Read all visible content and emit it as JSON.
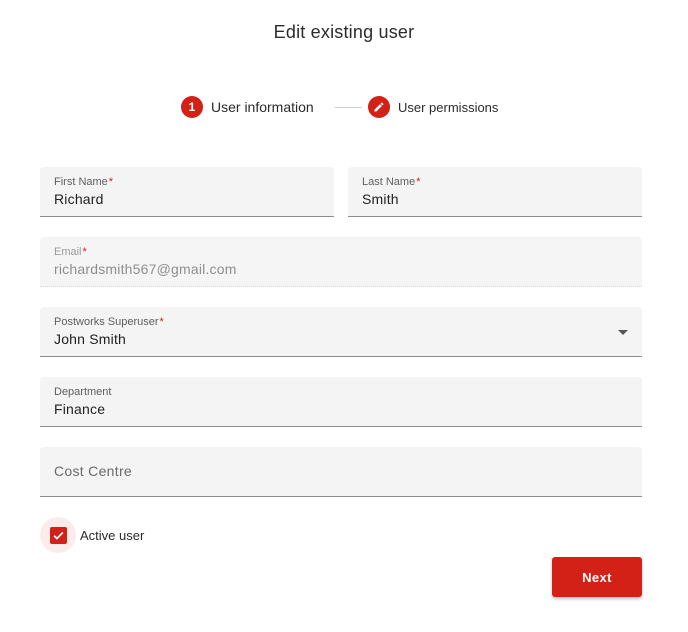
{
  "page": {
    "title": "Edit existing user"
  },
  "stepper": {
    "steps": [
      {
        "number": "1",
        "label": "User information",
        "icon": "step-number-icon",
        "state": "active"
      },
      {
        "label": "User permissions",
        "icon": "pencil-icon",
        "state": "editable"
      }
    ]
  },
  "form": {
    "first_name": {
      "label": "First Name",
      "required_mark": "*",
      "value": "Richard"
    },
    "last_name": {
      "label": "Last Name",
      "required_mark": "*",
      "value": "Smith"
    },
    "email": {
      "label": "Email",
      "required_mark": "*",
      "value": "richardsmith567@gmail.com",
      "disabled": true
    },
    "superuser": {
      "label": "Postworks Superuser",
      "required_mark": "*",
      "value": "John Smith",
      "icon": "chevron-down-icon"
    },
    "department": {
      "label": "Department",
      "value": "Finance"
    },
    "cost_centre": {
      "placeholder": "Cost Centre",
      "value": ""
    },
    "active_user": {
      "label": "Active user",
      "checked": true,
      "icon": "checkmark-icon"
    }
  },
  "actions": {
    "next_label": "Next"
  },
  "colors": {
    "accent": "#d32118",
    "field_background": "#f4f4f4",
    "text": "#212121"
  }
}
